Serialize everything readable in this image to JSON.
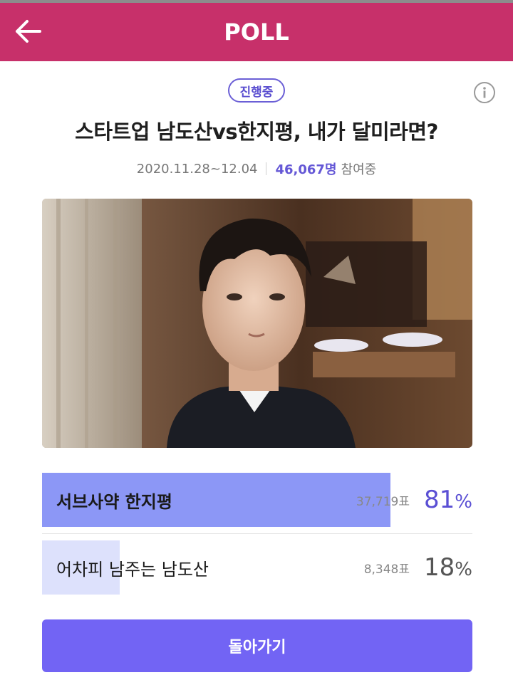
{
  "header": {
    "title": "POLL",
    "back_icon": "arrow-left-icon"
  },
  "poll": {
    "status": "진행중",
    "info_icon": "info-icon",
    "title": "스타트업 남도산vs한지평, 내가 달미라면?",
    "period": "2020.11.28~12.04",
    "participants": "46,067명",
    "participants_suffix": "참여중"
  },
  "options": [
    {
      "label": "서브사약 한지평",
      "votes": "37,719표",
      "percent": "81",
      "percent_sign": "%",
      "fraction": 0.81
    },
    {
      "label": "어차피 남주는 남도산",
      "votes": "8,348표",
      "percent": "18",
      "percent_sign": "%",
      "fraction": 0.18
    }
  ],
  "footer": {
    "back_button": "돌아가기"
  },
  "colors": {
    "header": "#c7306a",
    "accent": "#6457d6",
    "winner_fill": "#8c97f6",
    "other_fill": "#dde1fc",
    "button": "#7264f4"
  }
}
